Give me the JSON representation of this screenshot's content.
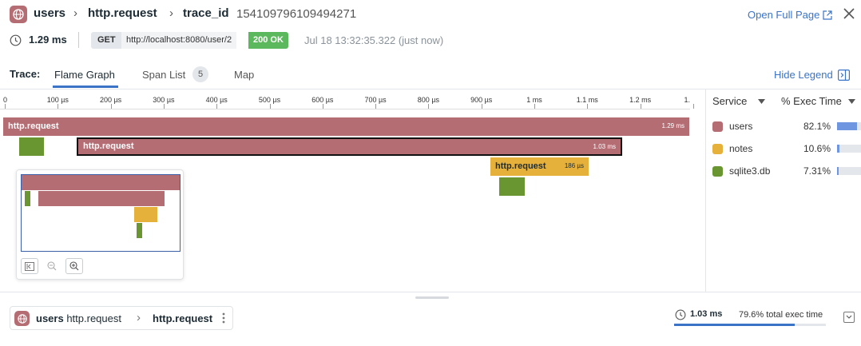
{
  "header": {
    "service": "users",
    "operation": "http.request",
    "trace_id_label": "trace_id",
    "trace_id": "154109796109494271",
    "open_full_page": "Open Full Page",
    "duration": "1.29 ms",
    "method": "GET",
    "url": "http://localhost:8080/user/2",
    "status": "200 OK",
    "timestamp": "Jul 18 13:32:35.322 (just now)"
  },
  "tabs": {
    "label": "Trace:",
    "items": [
      {
        "label": "Flame Graph",
        "active": true
      },
      {
        "label": "Span List",
        "count": "5"
      },
      {
        "label": "Map"
      }
    ],
    "hide_legend": "Hide Legend"
  },
  "axis": {
    "ticks": [
      "0",
      "100 µs",
      "200 µs",
      "300 µs",
      "400 µs",
      "500 µs",
      "600 µs",
      "700 µs",
      "800 µs",
      "900 µs",
      "1 ms",
      "1.1 ms",
      "1.2 ms",
      "1."
    ]
  },
  "flame": {
    "spans": [
      {
        "name": "http.request",
        "duration": "1.29 ms",
        "service": "users"
      },
      {
        "name": "",
        "service": "sqlite3.db"
      },
      {
        "name": "http.request",
        "duration": "1.03 ms",
        "service": "users",
        "selected": true
      },
      {
        "name": "http.request",
        "duration": "186 µs",
        "service": "notes"
      },
      {
        "name": "",
        "service": "sqlite3.db"
      }
    ]
  },
  "colors": {
    "users": "#b56d74",
    "notes": "#e6b13b",
    "sqlite3.db": "#6a9632",
    "accent": "#3b73c6",
    "status_ok": "#5cb85c"
  },
  "legend": {
    "service_header": "Service",
    "exec_header": "% Exec Time",
    "rows": [
      {
        "service": "users",
        "pct": "82.1%",
        "fraction": 0.821
      },
      {
        "service": "notes",
        "pct": "10.6%",
        "fraction": 0.106
      },
      {
        "service": "sqlite3.db",
        "pct": "7.31%",
        "fraction": 0.0731
      }
    ]
  },
  "bottom": {
    "service": "users",
    "parent_op": "http.request",
    "current_op": "http.request",
    "duration": "1.03 ms",
    "exec_text": "79.6% total exec time",
    "exec_fraction": 0.796
  }
}
